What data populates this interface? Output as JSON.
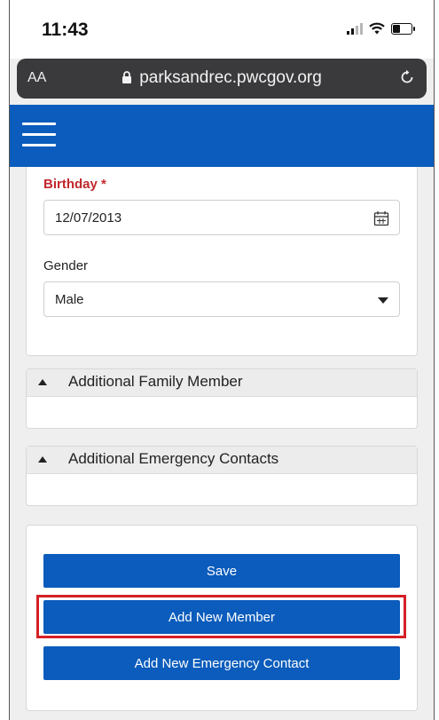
{
  "status_bar": {
    "time": "11:43",
    "icons": [
      "signal-icon",
      "wifi-icon",
      "battery-icon"
    ]
  },
  "browser": {
    "text_size_label": "AA",
    "url": "parksandrec.pwcgov.org",
    "icons": [
      "lock-icon",
      "reload-icon"
    ]
  },
  "header": {
    "menu_icon": "hamburger-menu-icon",
    "background": "#0b5cbc"
  },
  "form": {
    "birthday": {
      "label": "Birthday",
      "required_mark": "*",
      "value": "12/07/2013"
    },
    "gender": {
      "label": "Gender",
      "value": "Male"
    }
  },
  "sections": [
    {
      "title": "Additional Family Member"
    },
    {
      "title": "Additional Emergency Contacts"
    }
  ],
  "actions": {
    "save": "Save",
    "add_member": "Add New Member",
    "add_emergency_contact": "Add New Emergency Contact"
  },
  "colors": {
    "primary": "#0b5cbc",
    "required": "#c1272d",
    "highlight_border": "#d51f26"
  }
}
